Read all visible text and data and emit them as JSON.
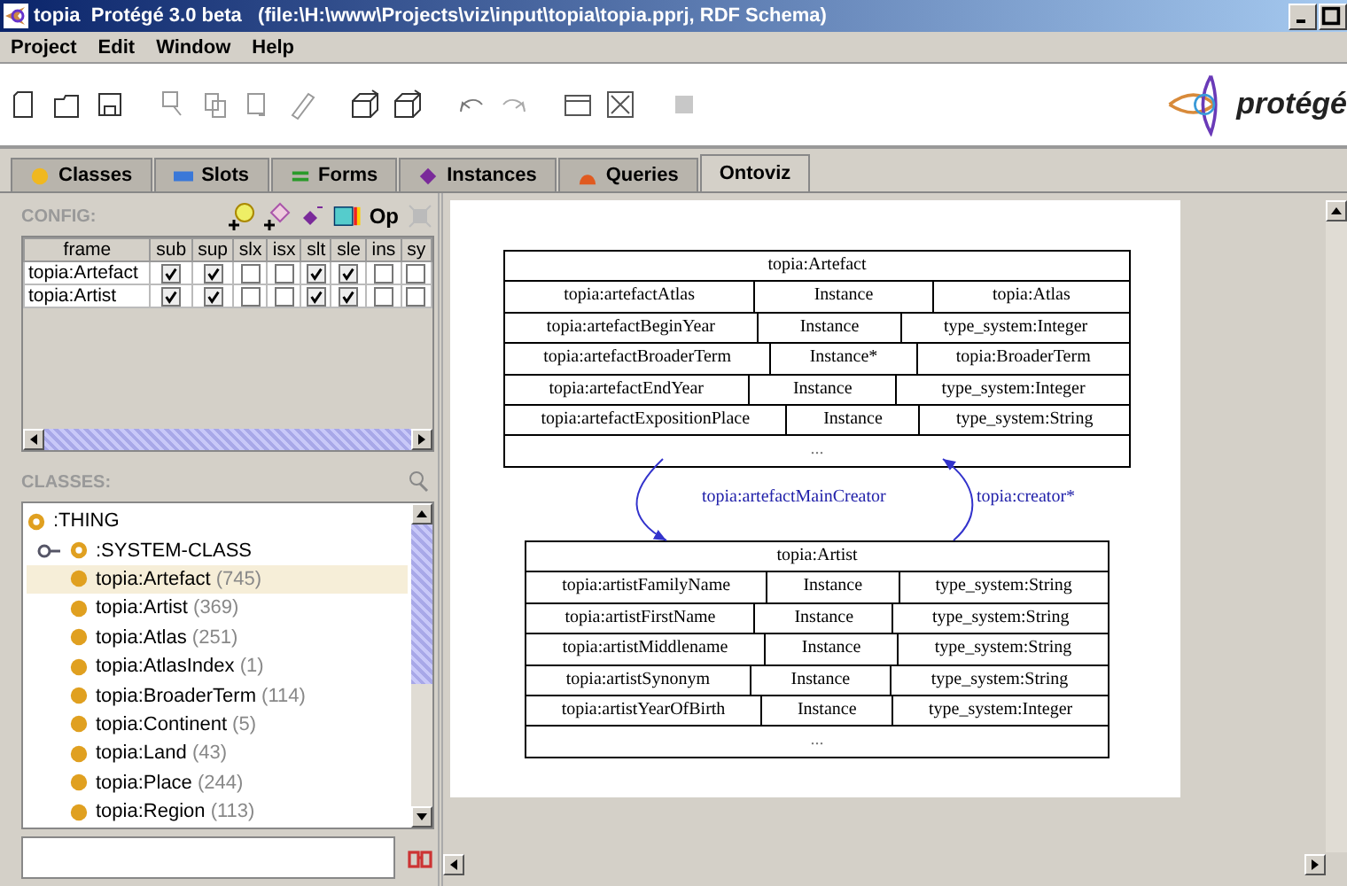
{
  "window": {
    "title": "topia  Protégé 3.0 beta   (file:\\H:\\www\\Projects\\viz\\input\\topia\\topia.pprj, RDF Schema)"
  },
  "menu": [
    "Project",
    "Edit",
    "Window",
    "Help"
  ],
  "logo": {
    "text": "protégé"
  },
  "tabs": [
    {
      "label": "Classes",
      "selected": false,
      "kind": "circle",
      "color": "#f0b820"
    },
    {
      "label": "Slots",
      "selected": false,
      "kind": "bar",
      "color": "#3a78d8"
    },
    {
      "label": "Forms",
      "selected": false,
      "kind": "lines",
      "color": "#2a9a2a"
    },
    {
      "label": "Instances",
      "selected": false,
      "kind": "diamond",
      "color": "#7a2a9a"
    },
    {
      "label": "Queries",
      "selected": false,
      "kind": "dome",
      "color": "#e05a20"
    },
    {
      "label": "Ontoviz",
      "selected": true
    }
  ],
  "config": {
    "label": "CONFIG:",
    "op_label": "Op",
    "columns": [
      "frame",
      "sub",
      "sup",
      "slx",
      "isx",
      "slt",
      "sle",
      "ins",
      "sy"
    ],
    "rows": [
      {
        "frame": "topia:Artefact",
        "checks": [
          true,
          true,
          false,
          false,
          true,
          true,
          false,
          false
        ]
      },
      {
        "frame": "topia:Artist",
        "checks": [
          true,
          true,
          false,
          false,
          true,
          true,
          false,
          false
        ]
      }
    ]
  },
  "classes": {
    "label": "CLASSES:",
    "tree": [
      {
        "name": ":THING",
        "abstract": true,
        "expanded": true,
        "children": [
          {
            "name": ":SYSTEM-CLASS",
            "abstract": true,
            "expanded": false
          },
          {
            "name": "topia:Artefact",
            "count": "(745)",
            "abstract": false,
            "selected": true
          },
          {
            "name": "topia:Artist",
            "count": "(369)",
            "abstract": false,
            "selected": false
          },
          {
            "name": "topia:Atlas",
            "count": "(251)",
            "abstract": false,
            "selected": false
          },
          {
            "name": "topia:AtlasIndex",
            "count": "(1)",
            "abstract": false,
            "selected": false
          },
          {
            "name": "topia:BroaderTerm",
            "count": "(114)",
            "abstract": false,
            "selected": false
          },
          {
            "name": "topia:Continent",
            "count": "(5)",
            "abstract": false,
            "selected": false
          },
          {
            "name": "topia:Land",
            "count": "(43)",
            "abstract": false,
            "selected": false
          },
          {
            "name": "topia:Place",
            "count": "(244)",
            "abstract": false,
            "selected": false
          },
          {
            "name": "topia:Region",
            "count": "(113)",
            "abstract": false,
            "selected": false
          }
        ]
      }
    ]
  },
  "diagram": {
    "nodes": [
      {
        "title": "topia:Artefact",
        "more": "...",
        "rows": [
          [
            "topia:artefactAtlas",
            "Instance",
            "topia:Atlas"
          ],
          [
            "topia:artefactBeginYear",
            "Instance",
            "type_system:Integer"
          ],
          [
            "topia:artefactBroaderTerm",
            "Instance*",
            "topia:BroaderTerm"
          ],
          [
            "topia:artefactEndYear",
            "Instance",
            "type_system:Integer"
          ],
          [
            "topia:artefactExpositionPlace",
            "Instance",
            "type_system:String"
          ]
        ]
      },
      {
        "title": "topia:Artist",
        "more": "...",
        "rows": [
          [
            "topia:artistFamilyName",
            "Instance",
            "type_system:String"
          ],
          [
            "topia:artistFirstName",
            "Instance",
            "type_system:String"
          ],
          [
            "topia:artistMiddlename",
            "Instance",
            "type_system:String"
          ],
          [
            "topia:artistSynonym",
            "Instance",
            "type_system:String"
          ],
          [
            "topia:artistYearOfBirth",
            "Instance",
            "type_system:Integer"
          ]
        ]
      }
    ],
    "edges": [
      {
        "label": "topia:artefactMainCreator"
      },
      {
        "label": "topia:creator*"
      }
    ]
  }
}
